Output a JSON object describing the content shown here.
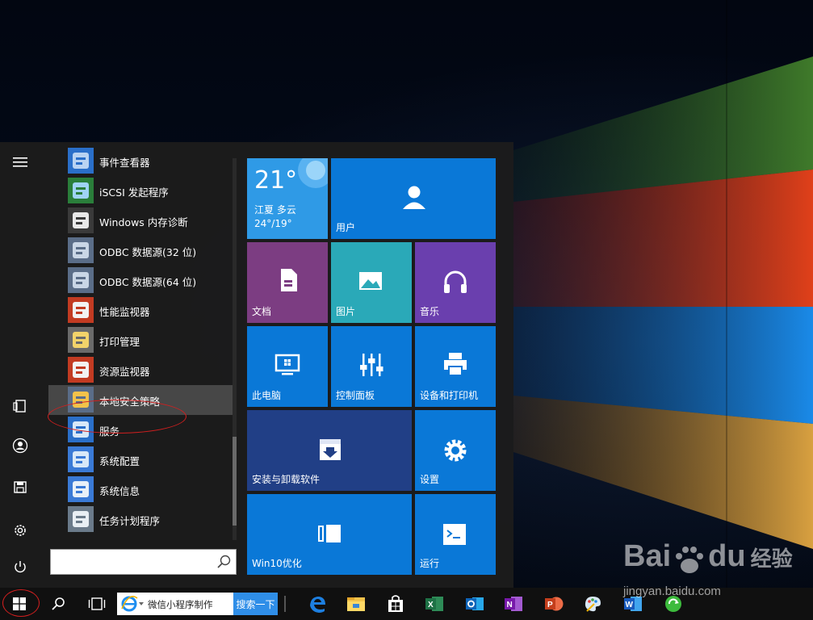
{
  "desktop": {
    "watermark": {
      "brand_a": "Bai",
      "brand_b": "du",
      "brand_c": "经验",
      "url": "jingyan.baidu.com"
    }
  },
  "start_menu": {
    "rail": [
      {
        "name": "hamburger-icon",
        "glyph": "≡"
      },
      {
        "name": "documents-icon"
      },
      {
        "name": "user-icon"
      },
      {
        "name": "pictures-icon"
      },
      {
        "name": "settings-icon"
      },
      {
        "name": "power-icon"
      }
    ],
    "apps": [
      {
        "label": "事件查看器",
        "icon": "event-viewer-icon"
      },
      {
        "label": "iSCSI 发起程序",
        "icon": "iscsi-icon"
      },
      {
        "label": "Windows 内存诊断",
        "icon": "memory-diagnostic-icon"
      },
      {
        "label": "ODBC 数据源(32 位)",
        "icon": "odbc-icon"
      },
      {
        "label": "ODBC 数据源(64 位)",
        "icon": "odbc-icon"
      },
      {
        "label": "性能监视器",
        "icon": "performance-monitor-icon"
      },
      {
        "label": "打印管理",
        "icon": "print-management-icon"
      },
      {
        "label": "资源监视器",
        "icon": "resource-monitor-icon"
      },
      {
        "label": "本地安全策略",
        "icon": "local-security-policy-icon"
      },
      {
        "label": "服务",
        "icon": "services-icon"
      },
      {
        "label": "系统配置",
        "icon": "system-config-icon"
      },
      {
        "label": "系统信息",
        "icon": "system-info-icon"
      },
      {
        "label": "任务计划程序",
        "icon": "task-scheduler-icon"
      }
    ],
    "highlighted_app": "本地安全策略",
    "search": {
      "placeholder": ""
    },
    "tiles": {
      "weather": {
        "temp": "21°",
        "city": "江夏 多云",
        "range": "24°/19°"
      },
      "user": "用户",
      "documents": "文档",
      "pictures": "图片",
      "music": "音乐",
      "this_pc": "此电脑",
      "control_panel": "控制面板",
      "devices_printers": "设备和打印机",
      "uninstall": "安装与卸载软件",
      "settings": "设置",
      "win10_opt": "Win10优化",
      "run": "运行"
    },
    "colors": {
      "tile_blue": "#0a78d7",
      "tile_purple": "#7c3d82",
      "tile_teal": "#2aa9b8",
      "tile_violet": "#6a3fae",
      "tile_navy": "#213f86",
      "weather_blue": "#2f9ae6"
    }
  },
  "taskbar": {
    "search_query": "微信小程序制作",
    "search_button": "搜索一下",
    "pinned": [
      "edge-icon",
      "file-explorer-icon",
      "store-icon",
      "excel-icon",
      "outlook-icon",
      "onenote-icon",
      "powerpoint-icon",
      "paint-icon",
      "word-icon",
      "baidu-icon"
    ]
  }
}
